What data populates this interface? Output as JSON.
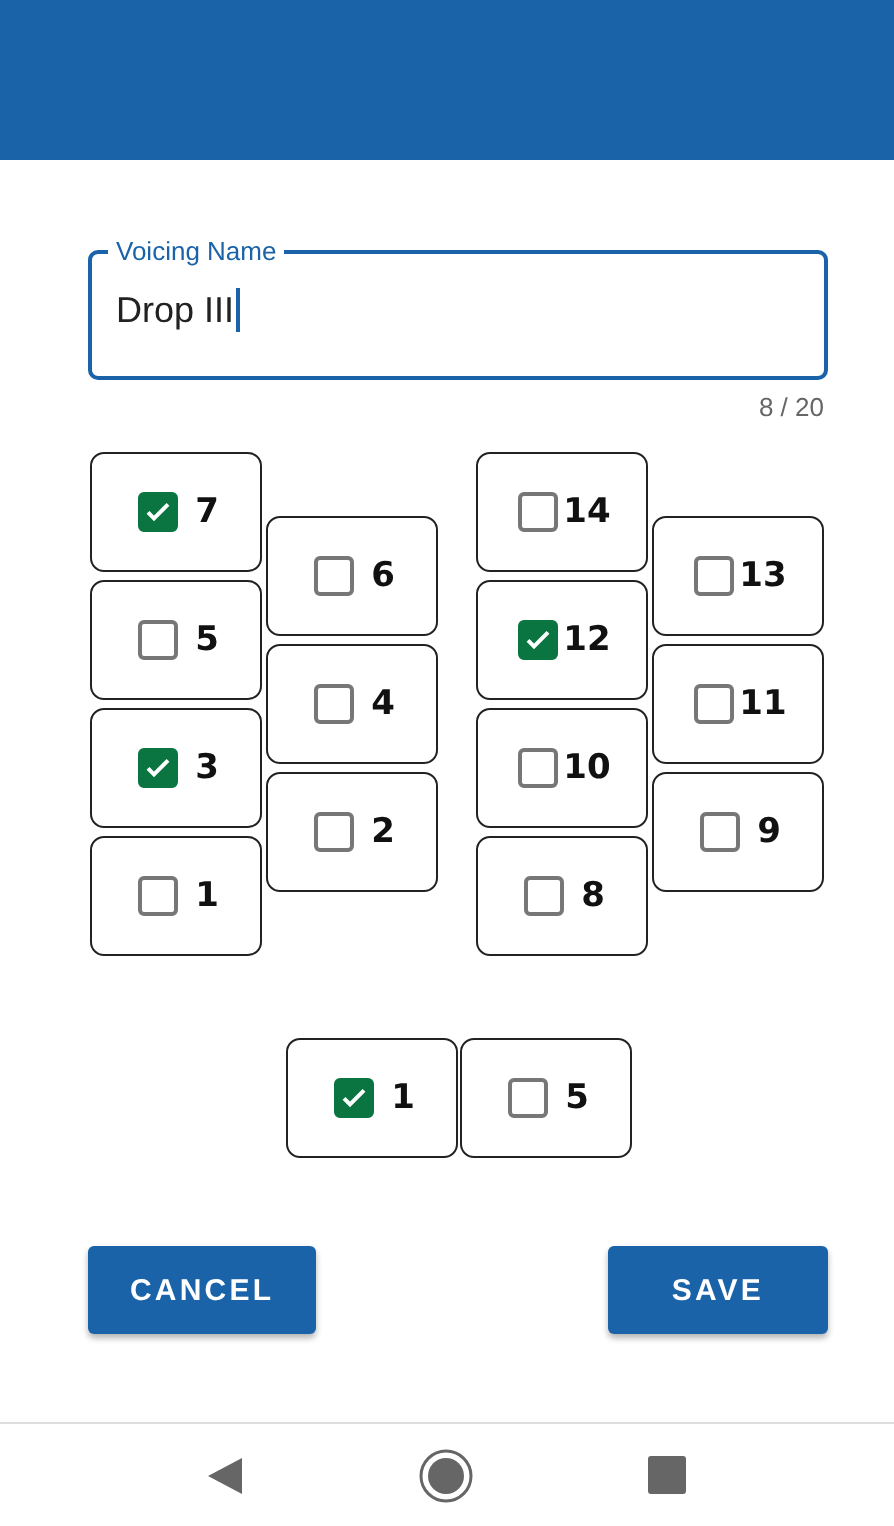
{
  "voicing_name": {
    "label": "Voicing Name",
    "value": "Drop III",
    "counter": "8 / 20"
  },
  "voice_groups": [
    {
      "column_1": [
        {
          "label": "7",
          "checked": true
        },
        {
          "label": "5",
          "checked": false
        },
        {
          "label": "3",
          "checked": true
        },
        {
          "label": "1",
          "checked": false
        }
      ],
      "column_2": [
        {
          "label": "6",
          "checked": false
        },
        {
          "label": "4",
          "checked": false
        },
        {
          "label": "2",
          "checked": false
        }
      ]
    },
    {
      "column_1": [
        {
          "label": "14",
          "checked": false
        },
        {
          "label": "12",
          "checked": true
        },
        {
          "label": "10",
          "checked": false
        },
        {
          "label": "8",
          "checked": false
        }
      ],
      "column_2": [
        {
          "label": "13",
          "checked": false
        },
        {
          "label": "11",
          "checked": false
        },
        {
          "label": "9",
          "checked": false
        }
      ]
    }
  ],
  "bottom_row": [
    {
      "label": "1",
      "checked": true
    },
    {
      "label": "5",
      "checked": false
    }
  ],
  "buttons": [
    "CANCEL",
    "SAVE"
  ]
}
